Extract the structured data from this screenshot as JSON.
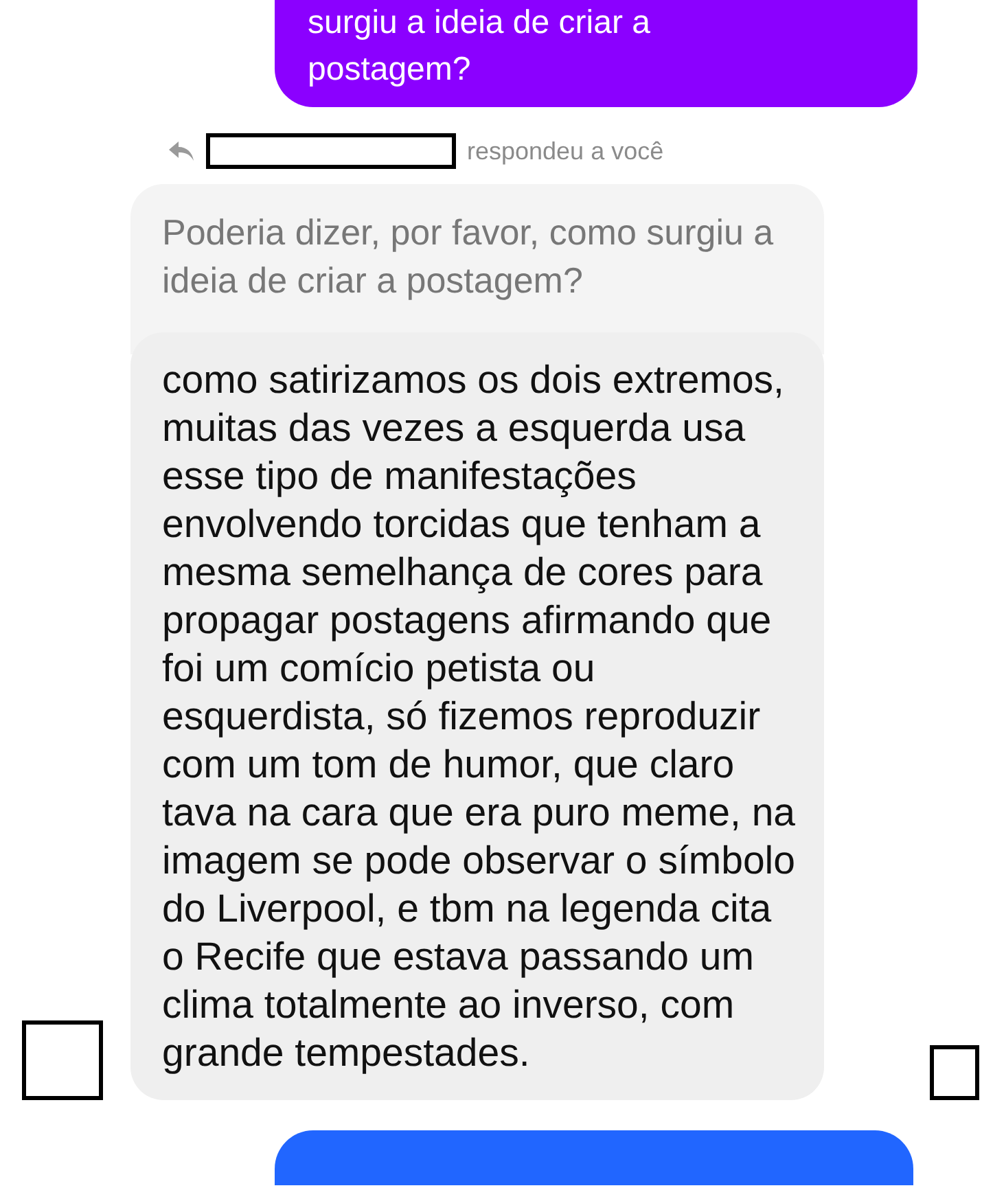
{
  "sent_message": {
    "lines": [
      "surgiu a ideia de criar a",
      "postagem?"
    ]
  },
  "reply_header": {
    "label": "respondeu a você"
  },
  "quoted_message": {
    "text": "Poderia dizer, por favor, como surgiu a ideia de criar a postagem?"
  },
  "received_message": {
    "text": "como satirizamos os dois extremos, muitas das vezes a esquerda usa esse tipo de manifestações envolvendo torcidas que tenham a mesma semelhança de cores para propagar postagens afirmando que foi um comício petista ou esquerdista, só fizemos reproduzir com um tom de humor, que claro tava na cara que era puro meme, na imagem se pode observar o símbolo do Liverpool, e tbm na legenda cita o Recife que estava passando um clima totalmente ao inverso, com grande tempestades."
  }
}
